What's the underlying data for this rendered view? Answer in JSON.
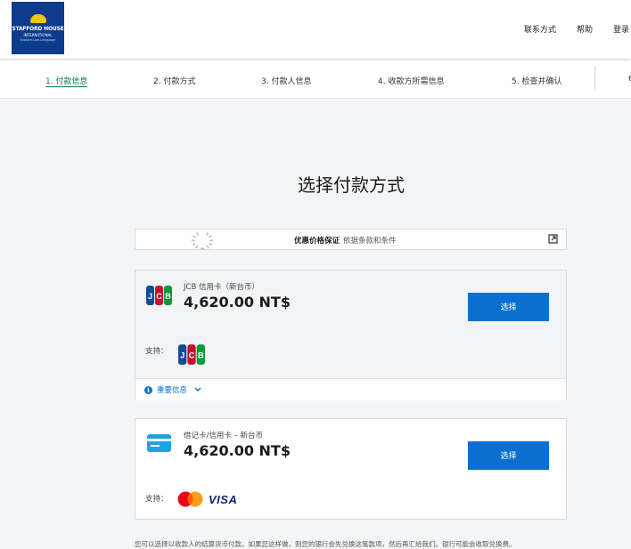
{
  "header": {
    "logo": {
      "line1": "STAFFORD HOUSE",
      "line2": "INTERNATIONAL",
      "line3": "Explore.Live.Language"
    },
    "nav": [
      "联系方式",
      "帮助",
      "登录"
    ]
  },
  "steps": [
    {
      "label": "1. 付款信息",
      "active": true
    },
    {
      "label": "2. 付款方式",
      "active": false
    },
    {
      "label": "3. 付款人信息",
      "active": false
    },
    {
      "label": "4. 收款方所需信息",
      "active": false
    },
    {
      "label": "5. 检查并确认",
      "active": false
    }
  ],
  "step_truncated": "6",
  "page_title": "选择付款方式",
  "guarantee": {
    "label": "优惠价格保证",
    "sub": "依据条款和条件",
    "external_link_icon": "external-link-icon"
  },
  "options": [
    {
      "currency_label": "JCB 信用卡（新台币）",
      "amount": "4,620.00 NT$",
      "button": "选择",
      "support_label": "支持：",
      "supported_icons": [
        "jcb-logo"
      ],
      "info_label": "重要信息",
      "icon": "jcb-icon"
    },
    {
      "currency_label": "借记卡/信用卡 – 新台币",
      "amount": "4,620.00 NT$",
      "button": "选择",
      "support_label": "支持：",
      "supported_icons": [
        "mastercard-logo",
        "visa-logo"
      ],
      "visa_text": "VISA",
      "icon": "credit-card-icon"
    }
  ],
  "footnote": "您可以选择以收款人的结算货币付款。如果您这样做，则您的银行会先兑换这笔款项，然后再汇给我们。银行可能会收取兑换费。",
  "colors": {
    "primary": "#0a6fce",
    "active_step": "#0b7a4b",
    "logo_bg": "#0d3b8c"
  }
}
